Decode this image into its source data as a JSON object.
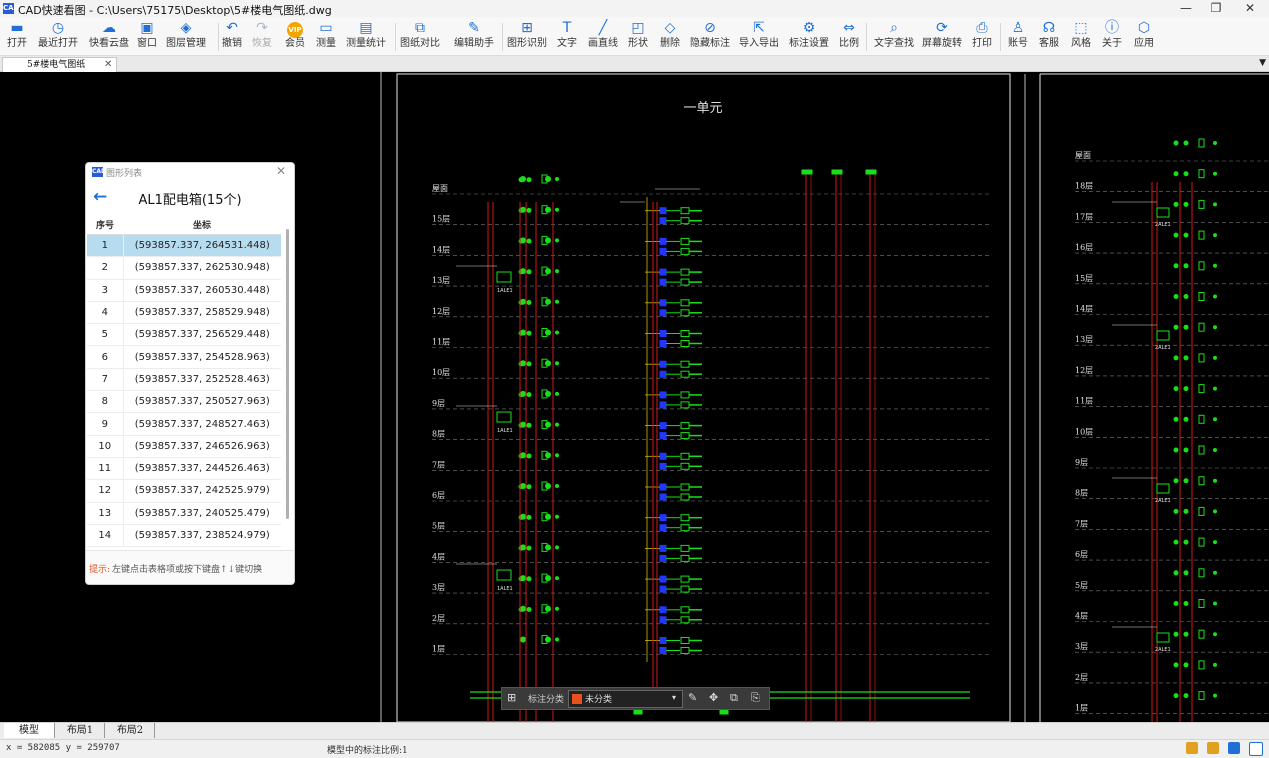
{
  "window": {
    "title": "CAD快速看图 - C:\\Users\\75175\\Desktop\\5#楼电气图纸.dwg",
    "logo_text": "CAD",
    "minimize_icon": "—",
    "maximize_icon": "❐",
    "close_icon": "✕"
  },
  "toolbar": [
    {
      "label": "打开",
      "icon": "folder-open-icon",
      "glyph": "▬",
      "enabled": true
    },
    {
      "label": "最近打开",
      "icon": "clock-history-icon",
      "glyph": "◷",
      "enabled": true
    },
    {
      "label": "快看云盘",
      "icon": "cloud-icon",
      "glyph": "☁",
      "enabled": true
    },
    {
      "label": "窗口",
      "icon": "window-icon",
      "glyph": "▣",
      "enabled": true
    },
    {
      "label": "图层管理",
      "icon": "layers-icon",
      "glyph": "◈",
      "enabled": true
    },
    {
      "label": "撤销",
      "icon": "undo-icon",
      "glyph": "↶",
      "enabled": true
    },
    {
      "label": "恢复",
      "icon": "redo-icon",
      "glyph": "↷",
      "enabled": false
    },
    {
      "label": "会员",
      "icon": "vip-icon",
      "glyph": "VIP",
      "enabled": true
    },
    {
      "label": "测量",
      "icon": "ruler-icon",
      "glyph": "▭",
      "enabled": true
    },
    {
      "label": "测量统计",
      "icon": "measure-stats-icon",
      "glyph": "▤",
      "enabled": true
    },
    {
      "label": "图纸对比",
      "icon": "compare-icon",
      "glyph": "⧉",
      "enabled": true
    },
    {
      "label": "编辑助手",
      "icon": "edit-assistant-icon",
      "glyph": "✎",
      "enabled": true
    },
    {
      "label": "图形识别",
      "icon": "shape-recognize-icon",
      "glyph": "⊞",
      "enabled": true
    },
    {
      "label": "文字",
      "icon": "text-icon",
      "glyph": "T",
      "enabled": true
    },
    {
      "label": "画直线",
      "icon": "line-icon",
      "glyph": "╱",
      "enabled": true
    },
    {
      "label": "形状",
      "icon": "shape-icon",
      "glyph": "◰",
      "enabled": true
    },
    {
      "label": "删除",
      "icon": "eraser-icon",
      "glyph": "◇",
      "enabled": true
    },
    {
      "label": "隐藏标注",
      "icon": "hide-annotation-icon",
      "glyph": "⊘",
      "enabled": true
    },
    {
      "label": "导入导出",
      "icon": "import-export-icon",
      "glyph": "⇱",
      "enabled": true
    },
    {
      "label": "标注设置",
      "icon": "annotation-settings-icon",
      "glyph": "⚙",
      "enabled": true
    },
    {
      "label": "比例",
      "icon": "scale-icon",
      "glyph": "⇔",
      "enabled": true
    },
    {
      "label": "文字查找",
      "icon": "text-search-icon",
      "glyph": "⌕",
      "enabled": true
    },
    {
      "label": "屏幕旋转",
      "icon": "rotate-screen-icon",
      "glyph": "⟳",
      "enabled": true
    },
    {
      "label": "打印",
      "icon": "printer-icon",
      "glyph": "⎙",
      "enabled": true
    },
    {
      "label": "账号",
      "icon": "user-icon",
      "glyph": "♙",
      "enabled": true
    },
    {
      "label": "客服",
      "icon": "headset-icon",
      "glyph": "☊",
      "enabled": true
    },
    {
      "label": "风格",
      "icon": "style-icon",
      "glyph": "⬚",
      "enabled": true
    },
    {
      "label": "关于",
      "icon": "info-icon",
      "glyph": "ⓘ",
      "enabled": true
    },
    {
      "label": "应用",
      "icon": "apps-icon",
      "glyph": "⬡",
      "enabled": true
    }
  ],
  "tabs": {
    "doc_tab_label": "5#楼电气图纸",
    "close_glyph": "✕",
    "menu_glyph": "▼"
  },
  "panel": {
    "title": "图形列表",
    "heading": "AL1配电箱(15个)",
    "back_glyph": "←",
    "close_glyph": "✕",
    "columns": [
      "序号",
      "坐标"
    ],
    "selected_index": 0,
    "rows": [
      {
        "index": "1",
        "coord": "(593857.337, 264531.448)"
      },
      {
        "index": "2",
        "coord": "(593857.337, 262530.948)"
      },
      {
        "index": "3",
        "coord": "(593857.337, 260530.448)"
      },
      {
        "index": "4",
        "coord": "(593857.337, 258529.948)"
      },
      {
        "index": "5",
        "coord": "(593857.337, 256529.448)"
      },
      {
        "index": "6",
        "coord": "(593857.337, 254528.963)"
      },
      {
        "index": "7",
        "coord": "(593857.337, 252528.463)"
      },
      {
        "index": "8",
        "coord": "(593857.337, 250527.963)"
      },
      {
        "index": "9",
        "coord": "(593857.337, 248527.463)"
      },
      {
        "index": "10",
        "coord": "(593857.337, 246526.963)"
      },
      {
        "index": "11",
        "coord": "(593857.337, 244526.463)"
      },
      {
        "index": "12",
        "coord": "(593857.337, 242525.979)"
      },
      {
        "index": "13",
        "coord": "(593857.337, 240525.479)"
      },
      {
        "index": "14",
        "coord": "(593857.337, 238524.979)"
      }
    ],
    "hint_prefix": "提示:",
    "hint_text": "左键点击表格项或按下键盘↑↓键切换"
  },
  "drawing": {
    "title": "一单元",
    "floors": [
      "屋面",
      "15层",
      "14层",
      "13层",
      "12层",
      "11层",
      "10层",
      "9层",
      "8层",
      "7层",
      "6层",
      "5层",
      "4层",
      "3层",
      "2层",
      "1层"
    ],
    "right_floors": [
      "屋面",
      "18层",
      "17层",
      "16层",
      "15层",
      "14层",
      "13层",
      "12层",
      "11层",
      "10层",
      "9层",
      "8层",
      "7层",
      "6层",
      "5层",
      "4层",
      "3层",
      "2层",
      "1层"
    ],
    "box_label": "1ALE1",
    "box_label_right": "2ALE1",
    "colors": {
      "green": "#18e018",
      "red": "#d01818",
      "blue": "#2236ff",
      "white": "#e0e0e0",
      "yellow": "#d0c000"
    }
  },
  "floatbar": {
    "label": "标注分类",
    "category": "未分类",
    "category_color": "#e8501c",
    "grid_icon_glyph": "⊞",
    "dropdown_glyph": "▾",
    "tool_glyphs": [
      "✎",
      "✥",
      "⧉",
      "⎘"
    ]
  },
  "layout_tabs": [
    "模型",
    "布局1",
    "布局2"
  ],
  "status": {
    "coords": "x = 582085 y = 259707",
    "scale_text": "模型中的标注比例:1"
  }
}
